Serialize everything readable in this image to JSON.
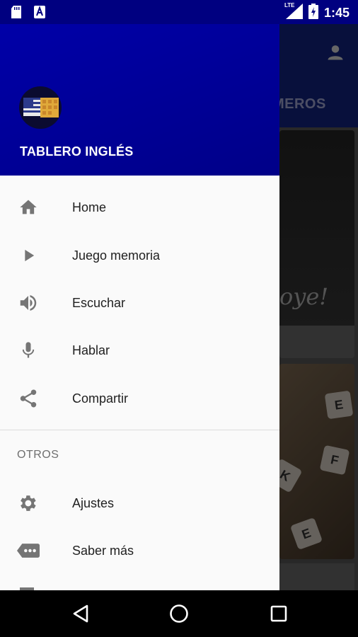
{
  "status_bar": {
    "time": "1:45",
    "network": "LTE",
    "notification_icons": [
      "sd-card-icon",
      "a-notification-icon"
    ]
  },
  "app": {
    "visible_tab": "ÚMEROS",
    "card_text": "oye!",
    "tiles": [
      "E",
      "F",
      "E",
      "K"
    ]
  },
  "drawer": {
    "title": "TABLERO INGLÉS",
    "items": [
      {
        "label": "Home",
        "icon": "home-icon"
      },
      {
        "label": "Juego memoria",
        "icon": "play-icon"
      },
      {
        "label": "Escuchar",
        "icon": "volume-icon"
      },
      {
        "label": "Hablar",
        "icon": "microphone-icon"
      },
      {
        "label": "Compartir",
        "icon": "share-icon"
      }
    ],
    "section_title": "OTROS",
    "other_items": [
      {
        "label": "Ajustes",
        "icon": "gear-icon"
      },
      {
        "label": "Saber más",
        "icon": "more-tag-icon"
      }
    ]
  },
  "colors": {
    "header": "#0000a0",
    "drawer_bg": "#fafafa",
    "icon": "#757575",
    "text": "#212121"
  }
}
